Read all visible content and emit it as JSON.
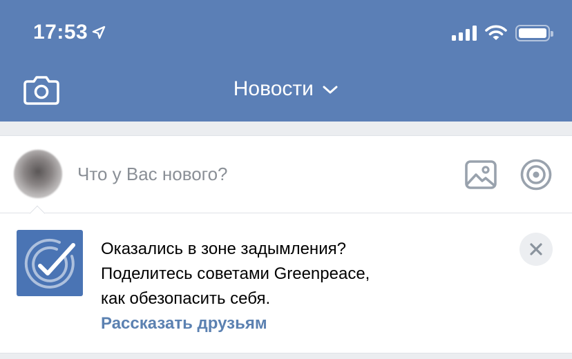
{
  "status_bar": {
    "time": "17:53"
  },
  "header": {
    "title": "Новости"
  },
  "compose": {
    "placeholder": "Что у Вас нового?"
  },
  "promo": {
    "lines": [
      "Оказались в зоне задымления?",
      "Поделитесь советами Greenpeace,",
      "как обезопасить себя."
    ],
    "link": "Рассказать друзьям"
  },
  "icons": {
    "status": [
      "location-arrow-icon",
      "signal-icon",
      "wifi-icon",
      "battery-icon"
    ],
    "header": [
      "camera-icon",
      "chevron-down-icon"
    ],
    "compose": [
      "photo-icon",
      "target-icon"
    ],
    "promo": [
      "promo-logo-icon",
      "close-icon"
    ]
  },
  "colors": {
    "header_bg": "#5b7fb6",
    "link": "#5b81b1",
    "page_bg": "#ebedf0",
    "icon_gray": "#99a2ad",
    "promo_logo_bg": "#4a74b4"
  }
}
